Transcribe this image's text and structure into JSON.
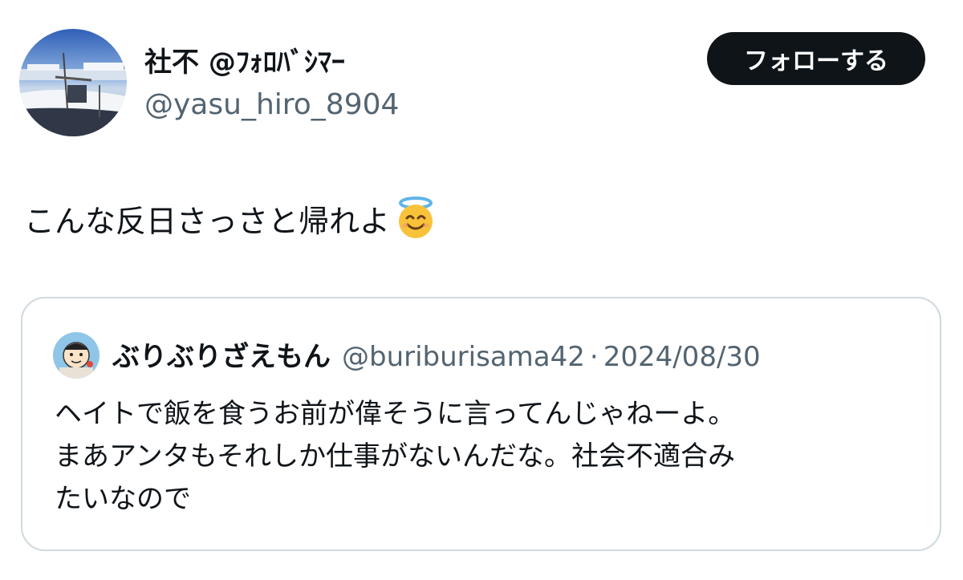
{
  "author": {
    "display_name": "社不 @ﾌｫﾛﾊﾞｼﾏｰ",
    "handle": "@yasu_hiro_8904",
    "avatar_icon": "boat-photo-avatar"
  },
  "follow_button": {
    "label": "フォローする"
  },
  "tweet": {
    "text": "こんな反日さっさと帰れよ",
    "emoji": "smiling-face-with-halo-icon"
  },
  "quoted_tweet": {
    "display_name": "ぶりぶりざえもん",
    "handle": "@buriburisama42",
    "separator": "·",
    "date": "2024/08/30",
    "lines": [
      "ヘイトで飯を食うお前が偉そうに言ってんじゃねーよ。",
      "まあアンタもそれしか仕事がないんだな。社会不適合み",
      "たいなので"
    ]
  },
  "colors": {
    "text": "#0f1419",
    "secondary": "#536471",
    "border": "#cfd9de",
    "button_bg": "#0f1419",
    "button_text": "#ffffff"
  }
}
